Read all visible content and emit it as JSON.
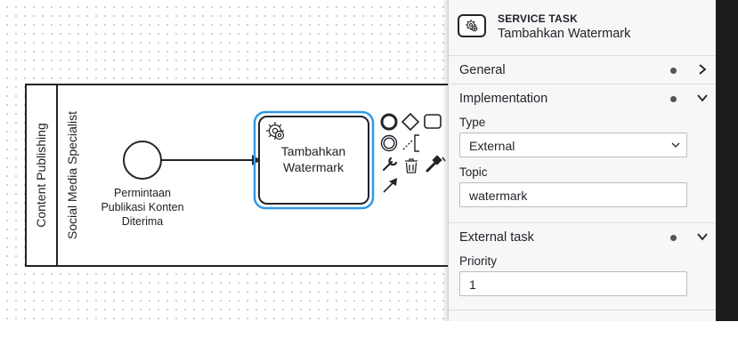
{
  "canvas": {
    "pool_label": "Content Publishing",
    "lane_label": "Social Media Specialist",
    "start_event": {
      "label_lines": [
        "Permintaan",
        "Publikasi Konten",
        "Diterima"
      ]
    },
    "task": {
      "label_lines": [
        "Tambahkan",
        "Watermark"
      ],
      "type_icon": "gear-icon"
    },
    "context_pad": [
      "end-event-icon",
      "gateway-icon",
      "task-icon",
      "intermediate-event-icon",
      "text-annotation-icon",
      "wrench-icon",
      "trash-icon",
      "color-picker-icon",
      "connect-arrow-icon"
    ]
  },
  "panel": {
    "header": {
      "type_label": "SERVICE TASK",
      "name": "Tambahkan Watermark",
      "icon": "gear-icon"
    },
    "groups": [
      {
        "title": "General",
        "expanded": false,
        "has_entries": true
      },
      {
        "title": "Implementation",
        "expanded": true,
        "has_entries": true,
        "fields": {
          "type_label": "Type",
          "type_value": "External",
          "topic_label": "Topic",
          "topic_value": "watermark"
        }
      },
      {
        "title": "External task",
        "expanded": true,
        "has_entries": true,
        "fields": {
          "priority_label": "Priority",
          "priority_value": "1"
        }
      }
    ]
  },
  "colors": {
    "selection": "#2f98e5",
    "panel_bg": "#f7f7f8",
    "stroke": "#22242a"
  }
}
